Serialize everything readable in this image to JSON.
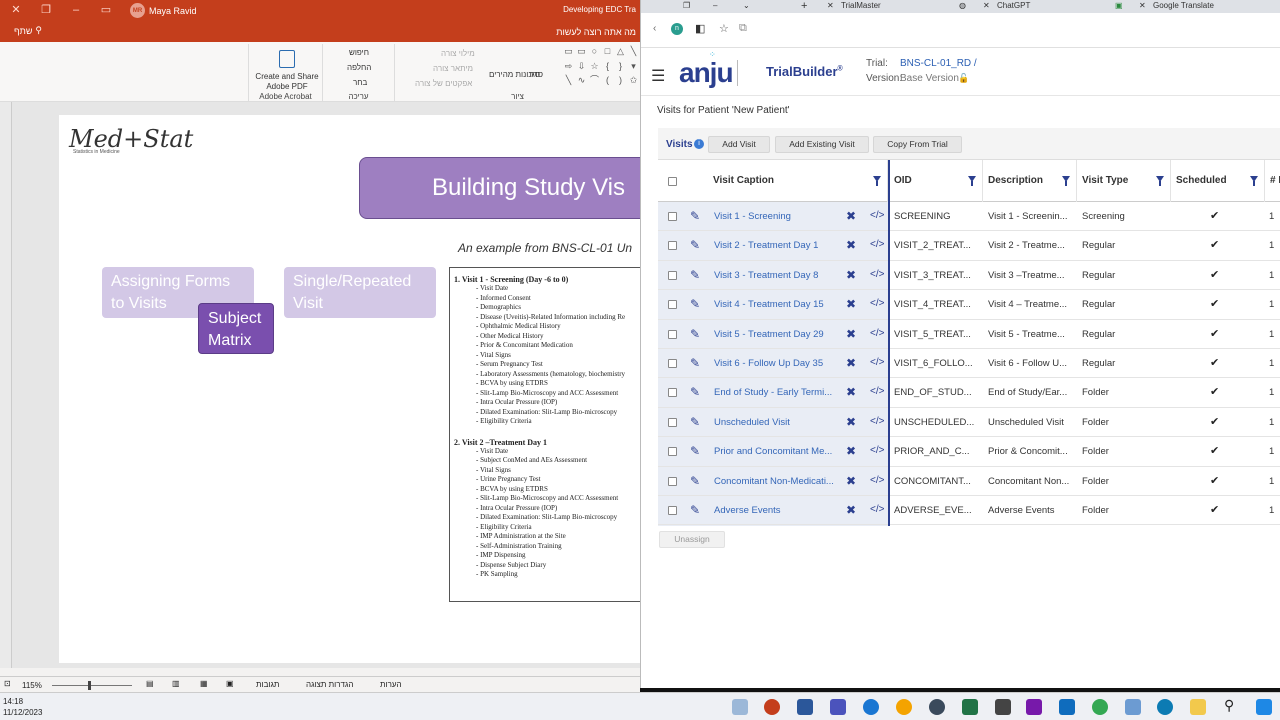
{
  "ppt": {
    "user": "Maya Ravid",
    "user_initials": "MR",
    "doc_title": "Developing EDC Tra",
    "share": "שתף",
    "tell_me": "מה אתה רוצה לעשות",
    "ribbon": {
      "acrobat_btn": "Create and Share Adobe PDF",
      "acrobat_group": "Adobe Acrobat",
      "find": "חיפוש",
      "replace": "החלפה",
      "select": "בחר",
      "editing_group": "עריכה",
      "shape_fill": "מילוי צורה",
      "shape_outline": "מיתאר צורה",
      "shape_effects": "אפקטים של צורה",
      "quick_styles": "סגנונות מהירים",
      "arrange": "סדר",
      "drawing_group": "ציור"
    },
    "slide": {
      "logo": "Med+Stat",
      "logo_sub": "Statistics in Medicine",
      "title": "Building Study Vis",
      "subtitle": "An example from BNS-CL-01 Un",
      "box_assign": "Assigning Forms to Visits",
      "box_single": "Single/Repeated Visit",
      "box_subject": "Subject Matrix",
      "visit1_heading": "1.  Visit 1 - Screening (Day -6 to 0)",
      "visit1_items": [
        "Visit Date",
        "Informed Consent",
        "Demographics",
        "Disease (Uveitis)-Related Information including Re",
        "Ophthalmic Medical History",
        "Other Medical History",
        "Prior & Concomitant Medication",
        "Vital Signs",
        "Serum Pregnancy Test",
        "Laboratory Assessments (hematology, biochemistry",
        "BCVA by using ETDRS",
        "Slit-Lamp Bio-Microscopy and ACC Assessment",
        "Intra Ocular Pressure (IOP)",
        "Dilated Examination: Slit-Lamp Bio-microscopy",
        "Eligibility Criteria"
      ],
      "visit2_heading": "2.  Visit 2 –Treatment Day 1",
      "visit2_items": [
        "Visit Date",
        "Subject ConMed and AEs Assessment",
        "Vital Signs",
        "Urine Pregnancy Test",
        "BCVA by using ETDRS",
        "Slit-Lamp Bio-Microscopy and ACC Assessment",
        "Intra Ocular Pressure (IOP)",
        "Dilated Examination: Slit-Lamp Bio-microscopy",
        "Eligibility Criteria",
        "IMP Administration at the Site",
        "Self-Administration Training",
        "IMP Dispensing",
        "Dispense Subject Diary",
        "PK Sampling"
      ]
    },
    "status": {
      "zoom": "115%",
      "comments": "הערות",
      "display": "הגדרות תצוגה",
      "notes": "תגובות"
    }
  },
  "browser": {
    "tabs": [
      "TrialMaster",
      "ChatGPT",
      "Google Translate"
    ],
    "app": {
      "brand": "anju",
      "product": "TrialBuilder",
      "trial_label": "Trial:",
      "trial_value": "BNS-CL-01_RD /",
      "version_label": "Version:",
      "version_value": "Base Version"
    },
    "visits_heading": "Visits for Patient 'New Patient'",
    "toolbar": {
      "label": "Visits",
      "add_visit": "Add Visit",
      "add_existing": "Add Existing Visit",
      "copy_from_trial": "Copy From Trial"
    },
    "columns": [
      "Visit Caption",
      "OID",
      "Description",
      "Visit Type",
      "Scheduled",
      "# F"
    ],
    "rows": [
      {
        "caption": "Visit 1 - Screening",
        "oid": "SCREENING",
        "desc": "Visit 1 - Screenin...",
        "type": "Screening",
        "count": "1"
      },
      {
        "caption": "Visit 2 - Treatment Day 1",
        "oid": "VISIT_2_TREAT...",
        "desc": "Visit 2 - Treatme...",
        "type": "Regular",
        "count": "1"
      },
      {
        "caption": "Visit 3 - Treatment Day 8",
        "oid": "VISIT_3_TREAT...",
        "desc": "Visit 3 –Treatme...",
        "type": "Regular",
        "count": "1"
      },
      {
        "caption": "Visit 4 - Treatment Day 15",
        "oid": "VISIT_4_TREAT...",
        "desc": "Visit 4 – Treatme...",
        "type": "Regular",
        "count": "1"
      },
      {
        "caption": "Visit 5 - Treatment Day 29",
        "oid": "VISIT_5_TREAT...",
        "desc": "Visit 5 - Treatme...",
        "type": "Regular",
        "count": "1"
      },
      {
        "caption": "Visit 6 - Follow Up Day 35",
        "oid": "VISIT_6_FOLLO...",
        "desc": "Visit 6 - Follow U...",
        "type": "Regular",
        "count": "1"
      },
      {
        "caption": "End of Study - Early Termi...",
        "oid": "END_OF_STUD...",
        "desc": "End of Study/Ear...",
        "type": "Folder",
        "count": "1"
      },
      {
        "caption": "Unscheduled Visit",
        "oid": "UNSCHEDULED...",
        "desc": "Unscheduled Visit",
        "type": "Folder",
        "count": "1"
      },
      {
        "caption": "Prior and Concomitant Me...",
        "oid": "PRIOR_AND_C...",
        "desc": "Prior & Concomit...",
        "type": "Folder",
        "count": "1"
      },
      {
        "caption": "Concomitant Non-Medicati...",
        "oid": "CONCOMITANT...",
        "desc": "Concomitant Non...",
        "type": "Folder",
        "count": "1"
      },
      {
        "caption": "Adverse Events",
        "oid": "ADVERSE_EVE...",
        "desc": "Adverse Events",
        "type": "Folder",
        "count": "1"
      }
    ],
    "unassign": "Unassign"
  },
  "taskbar": {
    "time": "14:18",
    "date": "11/12/2023"
  }
}
